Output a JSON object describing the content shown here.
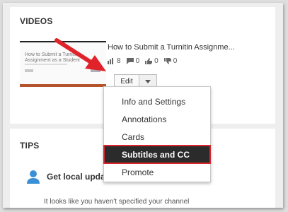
{
  "videos": {
    "title": "VIDEOS",
    "thumbnail": {
      "line1": "How to Submit a Turnitin",
      "line2": "Assignment as a Student"
    },
    "video_title": "How to Submit a Turnitin Assignme...",
    "stats": {
      "views": "8",
      "comments": "0",
      "likes": "0",
      "dislikes": "0"
    },
    "edit_label": "Edit"
  },
  "menu": {
    "items": [
      {
        "label": "Info and Settings"
      },
      {
        "label": "Annotations"
      },
      {
        "label": "Cards"
      },
      {
        "label": "Subtitles and CC"
      },
      {
        "label": "Promote"
      }
    ],
    "selected_index": 3
  },
  "tips": {
    "title": "TIPS",
    "item_title": "Get local upda",
    "item_desc": "It looks like you haven't specified your channel"
  },
  "colors": {
    "highlight_border": "#d8262c",
    "arrow": "#e0232b",
    "thumb_bar": "#b5542c",
    "selected_bg": "#2b2b2b"
  },
  "icons": [
    "views-icon",
    "comment-icon",
    "like-icon",
    "dislike-icon",
    "caret-down-icon",
    "user-icon",
    "red-arrow"
  ]
}
